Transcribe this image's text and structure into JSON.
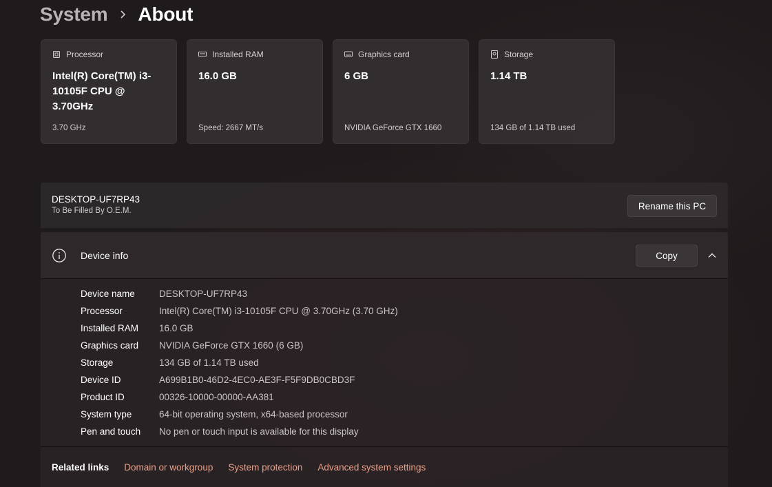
{
  "breadcrumb": {
    "parent": "System",
    "current": "About"
  },
  "cards": [
    {
      "label": "Processor",
      "icon": "processor-icon",
      "value": "Intel(R) Core(TM) i3-10105F CPU @ 3.70GHz",
      "sub": "3.70 GHz"
    },
    {
      "label": "Installed RAM",
      "icon": "ram-icon",
      "value": "16.0 GB",
      "sub": "Speed: 2667 MT/s"
    },
    {
      "label": "Graphics card",
      "icon": "graphics-card-icon",
      "value": "6 GB",
      "sub": "NVIDIA GeForce GTX 1660"
    },
    {
      "label": "Storage",
      "icon": "storage-icon",
      "value": "1.14 TB",
      "sub": "134 GB of 1.14 TB used"
    }
  ],
  "pc": {
    "name": "DESKTOP-UF7RP43",
    "model": "To Be Filled By O.E.M.",
    "rename_label": "Rename this PC"
  },
  "device_info": {
    "title": "Device info",
    "copy_label": "Copy",
    "rows": [
      {
        "key": "Device name",
        "value": "DESKTOP-UF7RP43"
      },
      {
        "key": "Processor",
        "value": "Intel(R) Core(TM) i3-10105F CPU @ 3.70GHz (3.70 GHz)"
      },
      {
        "key": "Installed RAM",
        "value": "16.0 GB"
      },
      {
        "key": "Graphics card",
        "value": "NVIDIA GeForce GTX 1660 (6 GB)"
      },
      {
        "key": "Storage",
        "value": "134 GB of 1.14 TB used"
      },
      {
        "key": "Device ID",
        "value": "A699B1B0-46D2-4EC0-AE3F-F5F9DB0CBD3F"
      },
      {
        "key": "Product ID",
        "value": "00326-10000-00000-AA381"
      },
      {
        "key": "System type",
        "value": "64-bit operating system, x64-based processor"
      },
      {
        "key": "Pen and touch",
        "value": "No pen or touch input is available for this display"
      }
    ]
  },
  "related": {
    "label": "Related links",
    "links": [
      "Domain or workgroup",
      "System protection",
      "Advanced system settings"
    ]
  },
  "colors": {
    "background": "#1f1b1c",
    "card": "#343031",
    "link_accent": "#e8a18a"
  }
}
